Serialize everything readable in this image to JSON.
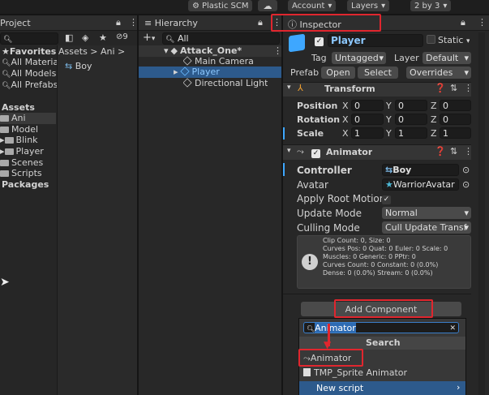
{
  "toolbar": {
    "plastic_scm": "Plastic SCM",
    "account": "Account",
    "layers": "Layers",
    "layout": "2 by 3"
  },
  "project": {
    "tab": "Project",
    "add": "+",
    "search_icon": "search-icon",
    "badge_count": "9",
    "favorites_title": "Favorites",
    "favorites": [
      "All Materia",
      "All Models",
      "All Prefabs"
    ],
    "assets_title": "Assets",
    "folders": [
      "Ani",
      "Model",
      "Blink",
      "Player",
      "Scenes",
      "Scripts"
    ],
    "packages_title": "Packages",
    "breadcrumb": "Assets > Ani >",
    "files": [
      "Boy"
    ]
  },
  "hierarchy": {
    "tab": "Hierarchy",
    "add": "+",
    "search": "All",
    "scene": "Attack_One*",
    "items": [
      "Main Camera",
      "Player",
      "Directional Light"
    ]
  },
  "inspector": {
    "tab": "Inspector",
    "object_name": "Player",
    "static_label": "Static",
    "tag_label": "Tag",
    "tag_value": "Untagged",
    "layer_label": "Layer",
    "layer_value": "Default",
    "prefab_label": "Prefab",
    "prefab_open": "Open",
    "prefab_select": "Select",
    "prefab_overrides": "Overrides",
    "transform": {
      "title": "Transform",
      "rows": [
        {
          "label": "Position",
          "x": "0",
          "y": "0",
          "z": "0"
        },
        {
          "label": "Rotation",
          "x": "0",
          "y": "0",
          "z": "0"
        },
        {
          "label": "Scale",
          "x": "1",
          "y": "1",
          "z": "1"
        }
      ],
      "axis_x": "X",
      "axis_y": "Y",
      "axis_z": "Z"
    },
    "animator": {
      "title": "Animator",
      "controller_label": "Controller",
      "controller_value": "Boy",
      "avatar_label": "Avatar",
      "avatar_value": "WarriorAvatar",
      "root_motion_label": "Apply Root Motion",
      "update_mode_label": "Update Mode",
      "update_mode_value": "Normal",
      "culling_mode_label": "Culling Mode",
      "culling_mode_value": "Cull Update Transf",
      "info": [
        "Clip Count: 0, Size: 0",
        "Curves Pos: 0 Quat: 0 Euler: 0 Scale: 0",
        "Muscles: 0 Generic: 0 PPtr: 0",
        "Curves Count: 0 Constant: 0 (0.0%)",
        "Dense: 0 (0.0%) Stream: 0 (0.0%)"
      ]
    },
    "add_component": "Add Component",
    "search_value": "Animator",
    "search_title": "Search",
    "results": [
      "Animator",
      "TMP_Sprite Animator",
      "New script"
    ]
  },
  "colors": {
    "highlight_red": "#e0262e",
    "selection_blue": "#2d5a8c"
  }
}
